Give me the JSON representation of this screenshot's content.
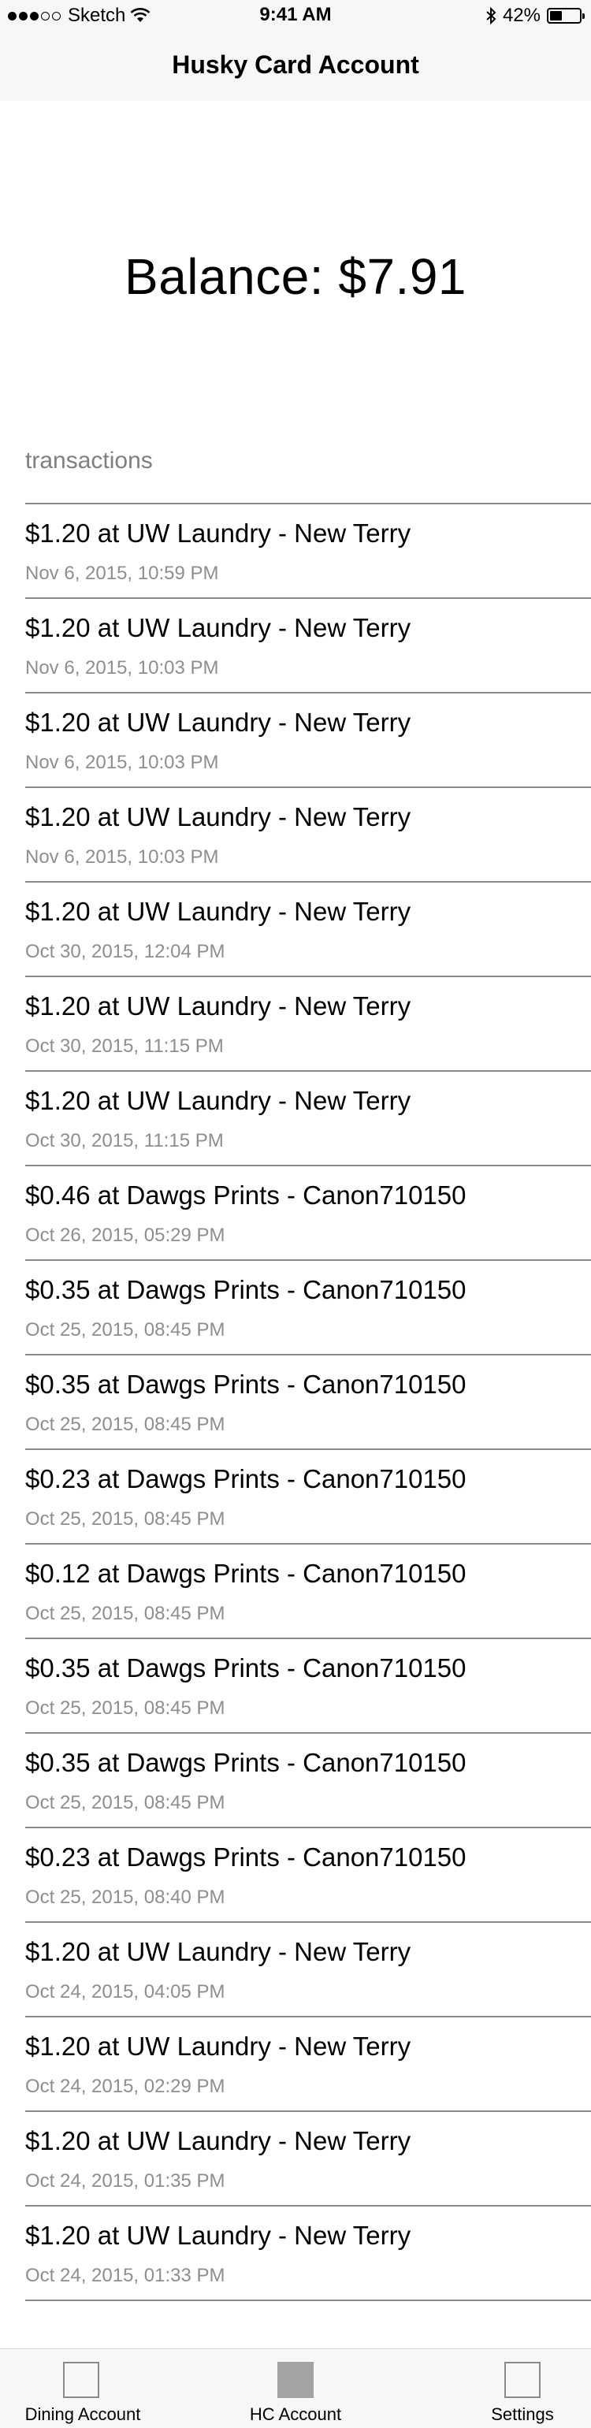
{
  "status_bar": {
    "carrier": "Sketch",
    "time": "9:41 AM",
    "battery": "42%",
    "battery_level": 0.42
  },
  "nav": {
    "title": "Husky Card Account"
  },
  "balance": {
    "text": "Balance: $7.91"
  },
  "section": {
    "label": "transactions"
  },
  "transactions": [
    {
      "title": "$1.20 at UW Laundry - New Terry",
      "date": "Nov 6, 2015, 10:59 PM"
    },
    {
      "title": "$1.20 at UW Laundry - New Terry",
      "date": "Nov 6, 2015, 10:03 PM"
    },
    {
      "title": "$1.20 at UW Laundry - New Terry",
      "date": "Nov 6, 2015, 10:03 PM"
    },
    {
      "title": "$1.20 at UW Laundry - New Terry",
      "date": "Nov 6, 2015, 10:03 PM"
    },
    {
      "title": "$1.20 at UW Laundry - New Terry",
      "date": "Oct 30, 2015, 12:04 PM"
    },
    {
      "title": "$1.20 at UW Laundry - New Terry",
      "date": "Oct 30, 2015, 11:15 PM"
    },
    {
      "title": "$1.20 at UW Laundry - New Terry",
      "date": "Oct 30, 2015, 11:15 PM"
    },
    {
      "title": "$0.46 at Dawgs Prints - Canon710150",
      "date": "Oct 26, 2015, 05:29 PM"
    },
    {
      "title": "$0.35 at Dawgs Prints - Canon710150",
      "date": "Oct 25, 2015, 08:45 PM"
    },
    {
      "title": "$0.35 at Dawgs Prints - Canon710150",
      "date": "Oct 25, 2015, 08:45 PM"
    },
    {
      "title": "$0.23 at Dawgs Prints - Canon710150",
      "date": "Oct 25, 2015, 08:45 PM"
    },
    {
      "title": "$0.12 at Dawgs Prints - Canon710150",
      "date": "Oct 25, 2015, 08:45 PM"
    },
    {
      "title": "$0.35 at Dawgs Prints - Canon710150",
      "date": "Oct 25, 2015, 08:45 PM"
    },
    {
      "title": "$0.35 at Dawgs Prints - Canon710150",
      "date": "Oct 25, 2015, 08:45 PM"
    },
    {
      "title": "$0.23 at Dawgs Prints - Canon710150",
      "date": "Oct 25, 2015, 08:40 PM"
    },
    {
      "title": "$1.20 at UW Laundry - New Terry",
      "date": "Oct 24, 2015, 04:05 PM"
    },
    {
      "title": "$1.20 at UW Laundry - New Terry",
      "date": "Oct 24, 2015, 02:29 PM"
    },
    {
      "title": "$1.20 at UW Laundry - New Terry",
      "date": "Oct 24, 2015, 01:35 PM"
    },
    {
      "title": "$1.20 at UW Laundry - New Terry",
      "date": "Oct 24, 2015, 01:33 PM"
    }
  ],
  "tabs": [
    {
      "label": "Dining Account",
      "icon": "dining-account-icon",
      "selected": false
    },
    {
      "label": "HC Account",
      "icon": "hc-account-icon",
      "selected": true
    },
    {
      "label": "Settings",
      "icon": "settings-icon",
      "selected": false
    }
  ],
  "colors": {
    "bar_background": "#f7f7f7",
    "separator": "#8a8a8a",
    "secondary_text": "#8e8e8e",
    "selected_tab_icon": "#a3a3a3"
  }
}
